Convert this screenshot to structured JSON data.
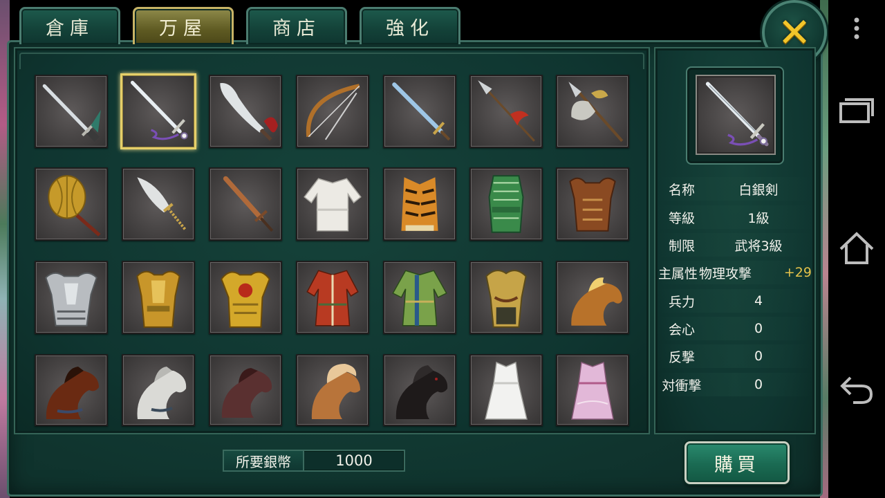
{
  "tabs": [
    {
      "label": "倉庫",
      "active": false
    },
    {
      "label": "万屋",
      "active": true
    },
    {
      "label": "商店",
      "active": false
    },
    {
      "label": "強化",
      "active": false
    }
  ],
  "close_icon": "close-x-icon",
  "accent_color": "#f3c52a",
  "items": [
    {
      "icon": "sword-tassel-icon"
    },
    {
      "icon": "white-silver-sword-icon",
      "selected": true
    },
    {
      "icon": "curved-blade-icon"
    },
    {
      "icon": "bow-icon"
    },
    {
      "icon": "blue-sword-icon"
    },
    {
      "icon": "spear-icon"
    },
    {
      "icon": "halberd-icon"
    },
    {
      "icon": "mace-icon"
    },
    {
      "icon": "broadsword-icon"
    },
    {
      "icon": "bronze-sword-icon"
    },
    {
      "icon": "white-robe-icon"
    },
    {
      "icon": "tiger-vest-icon"
    },
    {
      "icon": "green-armor-icon"
    },
    {
      "icon": "leather-armor-icon"
    },
    {
      "icon": "silver-armor-icon"
    },
    {
      "icon": "gold-armor-icon"
    },
    {
      "icon": "ornate-gold-armor-icon"
    },
    {
      "icon": "red-robe-icon"
    },
    {
      "icon": "green-robe-icon"
    },
    {
      "icon": "gold-plate-armor-icon"
    },
    {
      "icon": "chestnut-horse-icon"
    },
    {
      "icon": "bay-horse-icon"
    },
    {
      "icon": "white-horse-icon"
    },
    {
      "icon": "dark-bay-horse-icon"
    },
    {
      "icon": "palomino-horse-icon"
    },
    {
      "icon": "black-horse-icon"
    },
    {
      "icon": "white-dress-icon"
    },
    {
      "icon": "pink-dress-icon"
    }
  ],
  "detail": {
    "preview_icon": "white-silver-sword-icon",
    "stats": [
      {
        "label": "名称",
        "value": "白銀剣"
      },
      {
        "label": "等級",
        "value": "1級"
      },
      {
        "label": "制限",
        "value": "武将3級"
      },
      {
        "label": "主属性",
        "value": "物理攻撃",
        "bonus": "+29"
      },
      {
        "label": "兵力",
        "value": "4"
      },
      {
        "label": "会心",
        "value": "0"
      },
      {
        "label": "反撃",
        "value": "0"
      },
      {
        "label": "対衝撃",
        "value": "0"
      }
    ]
  },
  "cost": {
    "label": "所要銀幣",
    "value": "1000"
  },
  "buy_button": {
    "label": "購買"
  },
  "nav": {
    "menu_icon": "overflow-menu-icon",
    "recents_icon": "recent-apps-icon",
    "home_icon": "home-icon",
    "back_icon": "back-icon"
  }
}
